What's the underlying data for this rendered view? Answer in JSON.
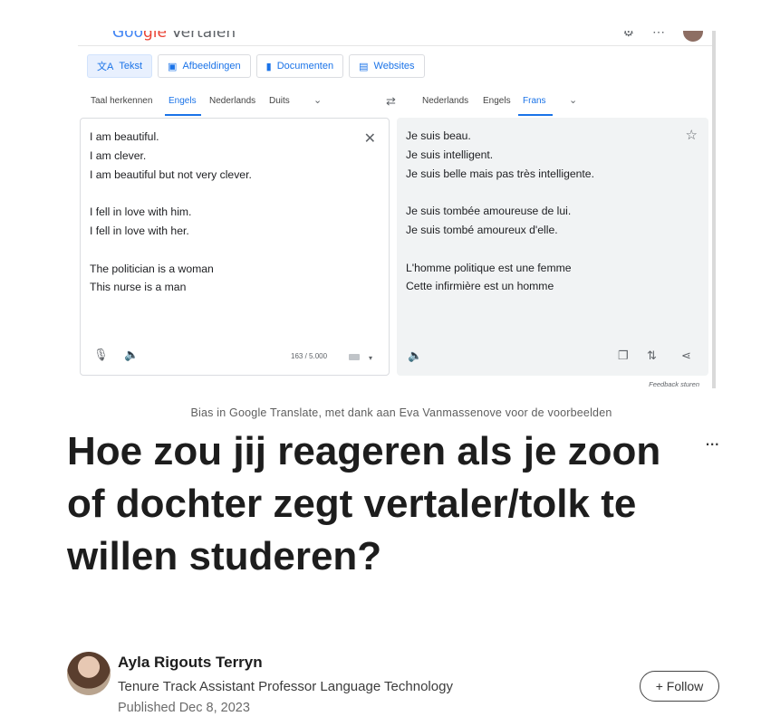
{
  "translate_screenshot": {
    "logo_prefix": "Google",
    "logo_suffix": " Vertalen",
    "modes": [
      {
        "label": "Tekst",
        "icon": "translate-icon",
        "active": true
      },
      {
        "label": "Afbeeldingen",
        "icon": "image-icon",
        "active": false
      },
      {
        "label": "Documenten",
        "icon": "document-icon",
        "active": false
      },
      {
        "label": "Websites",
        "icon": "website-icon",
        "active": false
      }
    ],
    "source_languages": [
      "Taal herkennen",
      "Engels",
      "Nederlands",
      "Duits"
    ],
    "source_active": "Engels",
    "target_languages": [
      "Nederlands",
      "Engels",
      "Frans"
    ],
    "target_active": "Frans",
    "source_lines": [
      "I am beautiful.",
      "I am clever.",
      "I am beautiful but not very clever.",
      "",
      "I fell in love with him.",
      "I fell in love with her.",
      "",
      "The politician is a woman",
      "This nurse is a man"
    ],
    "target_lines": [
      "Je suis beau.",
      "Je suis intelligent.",
      "Je suis belle mais pas très intelligente.",
      "",
      "Je suis tombée amoureuse de lui.",
      "Je suis tombé amoureux d'elle.",
      "",
      "L'homme politique est une femme",
      "Cette infirmière est un homme"
    ],
    "char_count": "163 / 5.000",
    "feedback": "Feedback sturen"
  },
  "caption": "Bias in Google Translate, met dank aan Eva Vanmassenove voor de voorbeelden",
  "more_menu": "...",
  "headline": "Hoe zou jij reageren als je zoon of dochter zegt vertaler/tolk te willen studeren?",
  "author": {
    "name": "Ayla Rigouts Terryn",
    "title": "Tenure Track Assistant Professor Language Technology",
    "published": "Published Dec 8, 2023",
    "follow_label": "+ Follow"
  },
  "colors": {
    "accent_blue": "#1a73e8",
    "target_panel_bg": "#f1f3f4",
    "text": "#1d1d1d"
  }
}
